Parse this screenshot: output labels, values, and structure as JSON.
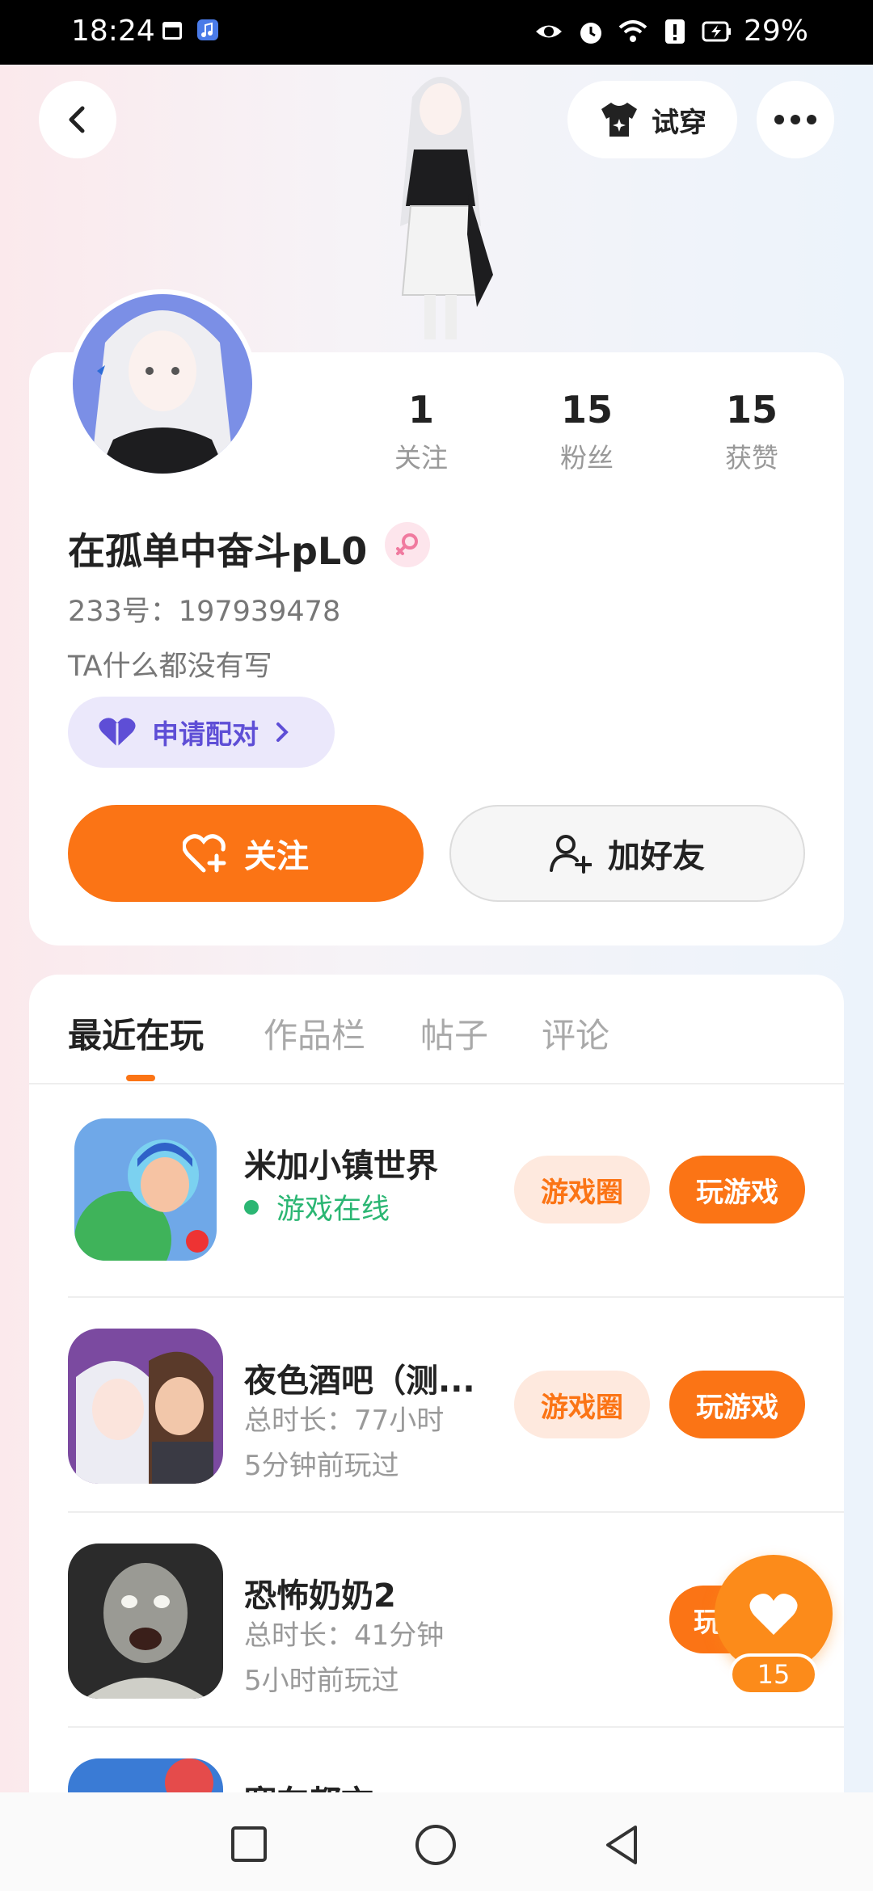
{
  "status": {
    "time": "18:24",
    "battery": "29%"
  },
  "header": {
    "try_on_label": "试穿"
  },
  "profile": {
    "username": "在孤单中奋斗pL0",
    "uid": "233号：197939478",
    "bio": "TA什么都没有写",
    "stats": [
      {
        "value": "1",
        "label": "关注"
      },
      {
        "value": "15",
        "label": "粉丝"
      },
      {
        "value": "15",
        "label": "获赞"
      }
    ],
    "pair_label": "申请配对",
    "follow_label": "关注",
    "add_friend_label": "加好友"
  },
  "tabs": [
    "最近在玩",
    "作品栏",
    "帖子",
    "评论"
  ],
  "games": [
    {
      "name": "米加小镇世界",
      "status": "游戏在线",
      "circle_label": "游戏圈",
      "play_label": "玩游戏"
    },
    {
      "name": "夜色酒吧（测...",
      "duration": "总时长：77小时",
      "last_played": "5分钟前玩过",
      "circle_label": "游戏圈",
      "play_label": "玩游戏"
    },
    {
      "name": "恐怖奶奶2",
      "duration": "总时长：41分钟",
      "last_played": "5小时前玩过",
      "play_label": "玩"
    },
    {
      "name": "赛车都市"
    }
  ],
  "like_count": "15",
  "colors": {
    "accent": "#fb7415",
    "online": "#2bb673",
    "pair": "#5e4ed6"
  }
}
